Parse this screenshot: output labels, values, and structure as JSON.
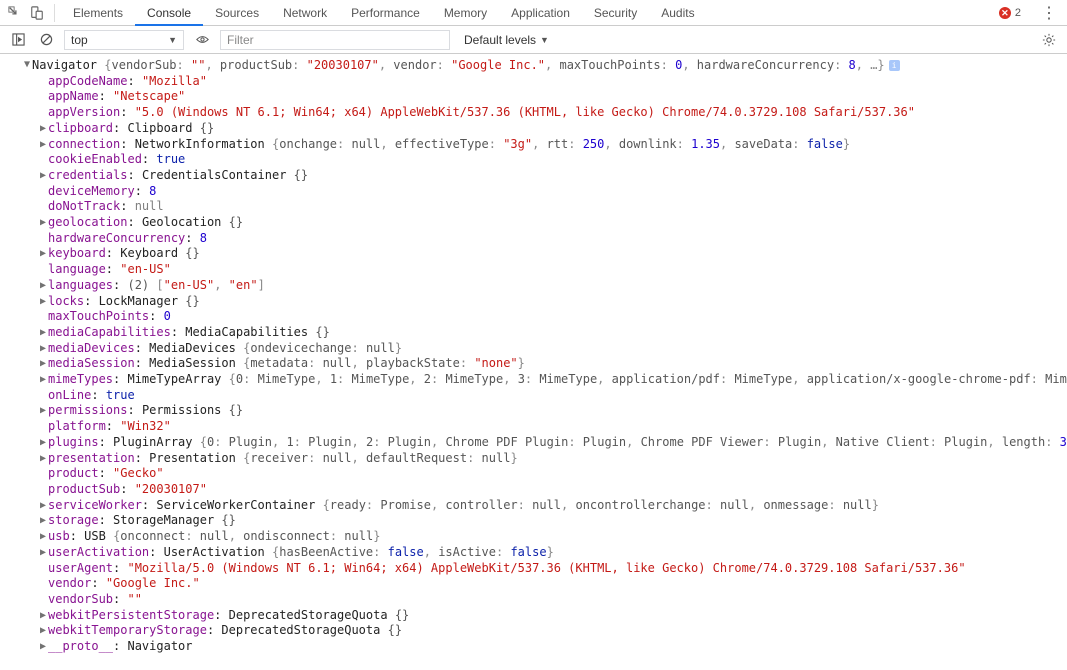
{
  "tabs": {
    "elements": "Elements",
    "console": "Console",
    "sources": "Sources",
    "network": "Network",
    "performance": "Performance",
    "memory": "Memory",
    "application": "Application",
    "security": "Security",
    "audits": "Audits"
  },
  "errorCount": "2",
  "toolbar": {
    "ctx": "top",
    "filter_ph": "Filter",
    "levels": "Default levels"
  },
  "nav": {
    "header": {
      "cls": "Navigator",
      "summary": {
        "vendorSub": "\"\"",
        "productSub": "\"20030107\"",
        "vendor": "\"Google Inc.\"",
        "maxTouchPoints": "0",
        "hardwareConcurrency": "8"
      }
    },
    "appCodeName": "\"Mozilla\"",
    "appName": "\"Netscape\"",
    "appVersion": "\"5.0 (Windows NT 6.1; Win64; x64) AppleWebKit/537.36 (KHTML, like Gecko) Chrome/74.0.3729.108 Safari/537.36\"",
    "clipboard": {
      "cls": "Clipboard",
      "obj": "{}"
    },
    "connection": {
      "cls": "NetworkInformation",
      "onchange": "null",
      "effectiveType": "\"3g\"",
      "rtt": "250",
      "downlink": "1.35",
      "saveData": "false"
    },
    "cookieEnabled": "true",
    "credentials": {
      "cls": "CredentialsContainer",
      "obj": "{}"
    },
    "deviceMemory": "8",
    "doNotTrack": "null",
    "geolocation": {
      "cls": "Geolocation",
      "obj": "{}"
    },
    "hardwareConcurrency": "8",
    "keyboard": {
      "cls": "Keyboard",
      "obj": "{}"
    },
    "language": "\"en-US\"",
    "languages": {
      "count": "(2)",
      "v0": "\"en-US\"",
      "v1": "\"en\""
    },
    "locks": {
      "cls": "LockManager",
      "obj": "{}"
    },
    "maxTouchPoints": "0",
    "mediaCapabilities": {
      "cls": "MediaCapabilities",
      "obj": "{}"
    },
    "mediaDevices": {
      "cls": "MediaDevices",
      "ondevicechange": "null"
    },
    "mediaSession": {
      "cls": "MediaSession",
      "metadata": "null",
      "playbackState": "\"none\""
    },
    "mimeTypes": {
      "cls": "MimeTypeArray",
      "k0": "0",
      "v0": "MimeType",
      "k1": "1",
      "v1": "MimeType",
      "k2": "2",
      "v2": "MimeType",
      "k3": "3",
      "v3": "MimeType",
      "ka": "application/pdf",
      "va": "MimeType",
      "kb": "application/x-google-chrome-pdf",
      "vb": "MimeType"
    },
    "onLine": "true",
    "permissions": {
      "cls": "Permissions",
      "obj": "{}"
    },
    "platform": "\"Win32\"",
    "plugins": {
      "cls": "PluginArray",
      "k0": "0",
      "v0": "Plugin",
      "k1": "1",
      "v1": "Plugin",
      "k2": "2",
      "v2": "Plugin",
      "ka": "Chrome PDF Plugin",
      "va": "Plugin",
      "kb": "Chrome PDF Viewer",
      "vb": "Plugin",
      "kc": "Native Client",
      "vc": "Plugin",
      "length": "3"
    },
    "presentation": {
      "cls": "Presentation",
      "receiver": "null",
      "defaultRequest": "null"
    },
    "product": "\"Gecko\"",
    "productSub": "\"20030107\"",
    "serviceWorker": {
      "cls": "ServiceWorkerContainer",
      "ready": "Promise",
      "controller": "null",
      "oncontrollerchange": "null",
      "onmessage": "null"
    },
    "storage": {
      "cls": "StorageManager",
      "obj": "{}"
    },
    "usb": {
      "cls": "USB",
      "onconnect": "null",
      "ondisconnect": "null"
    },
    "userActivation": {
      "cls": "UserActivation",
      "hasBeenActive": "false",
      "isActive": "false"
    },
    "userAgent": "\"Mozilla/5.0 (Windows NT 6.1; Win64; x64) AppleWebKit/537.36 (KHTML, like Gecko) Chrome/74.0.3729.108 Safari/537.36\"",
    "vendor": "\"Google Inc.\"",
    "vendorSub": "\"\"",
    "webkitPersistentStorage": {
      "cls": "DeprecatedStorageQuota",
      "obj": "{}"
    },
    "webkitTemporaryStorage": {
      "cls": "DeprecatedStorageQuota",
      "obj": "{}"
    },
    "proto": {
      "k": "__proto__",
      "cls": "Navigator"
    }
  }
}
